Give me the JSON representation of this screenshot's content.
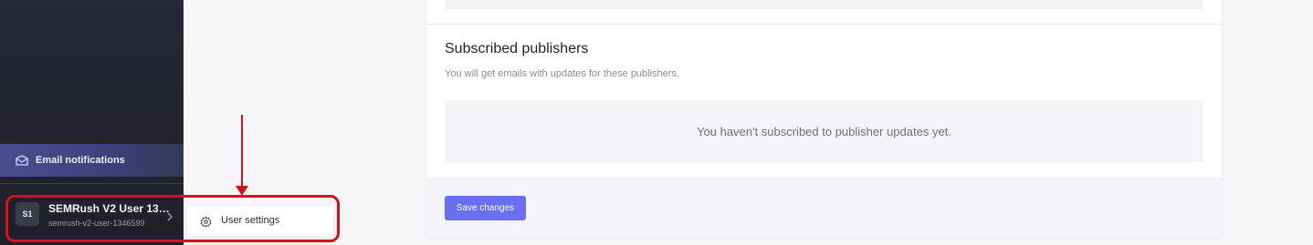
{
  "sidebar": {
    "active_item": {
      "label": "Email notifications",
      "icon": "mail-stack-icon"
    },
    "user": {
      "initials": "S1",
      "name": "SEMRush V2 User 13…",
      "username": "semrush-v2-user-1346599"
    }
  },
  "user_menu": {
    "items": [
      {
        "label": "User settings",
        "icon": "gear-icon"
      }
    ]
  },
  "main": {
    "section_title": "Subscribed publishers",
    "section_subtitle": "You will get emails with updates for these publishers.",
    "empty_state": "You haven't subscribed to publisher updates yet.",
    "save_label": "Save changes"
  },
  "colors": {
    "accent": "#6a6ef0",
    "annotation_red": "#d3121e",
    "sidebar_bg": "#23242f"
  }
}
